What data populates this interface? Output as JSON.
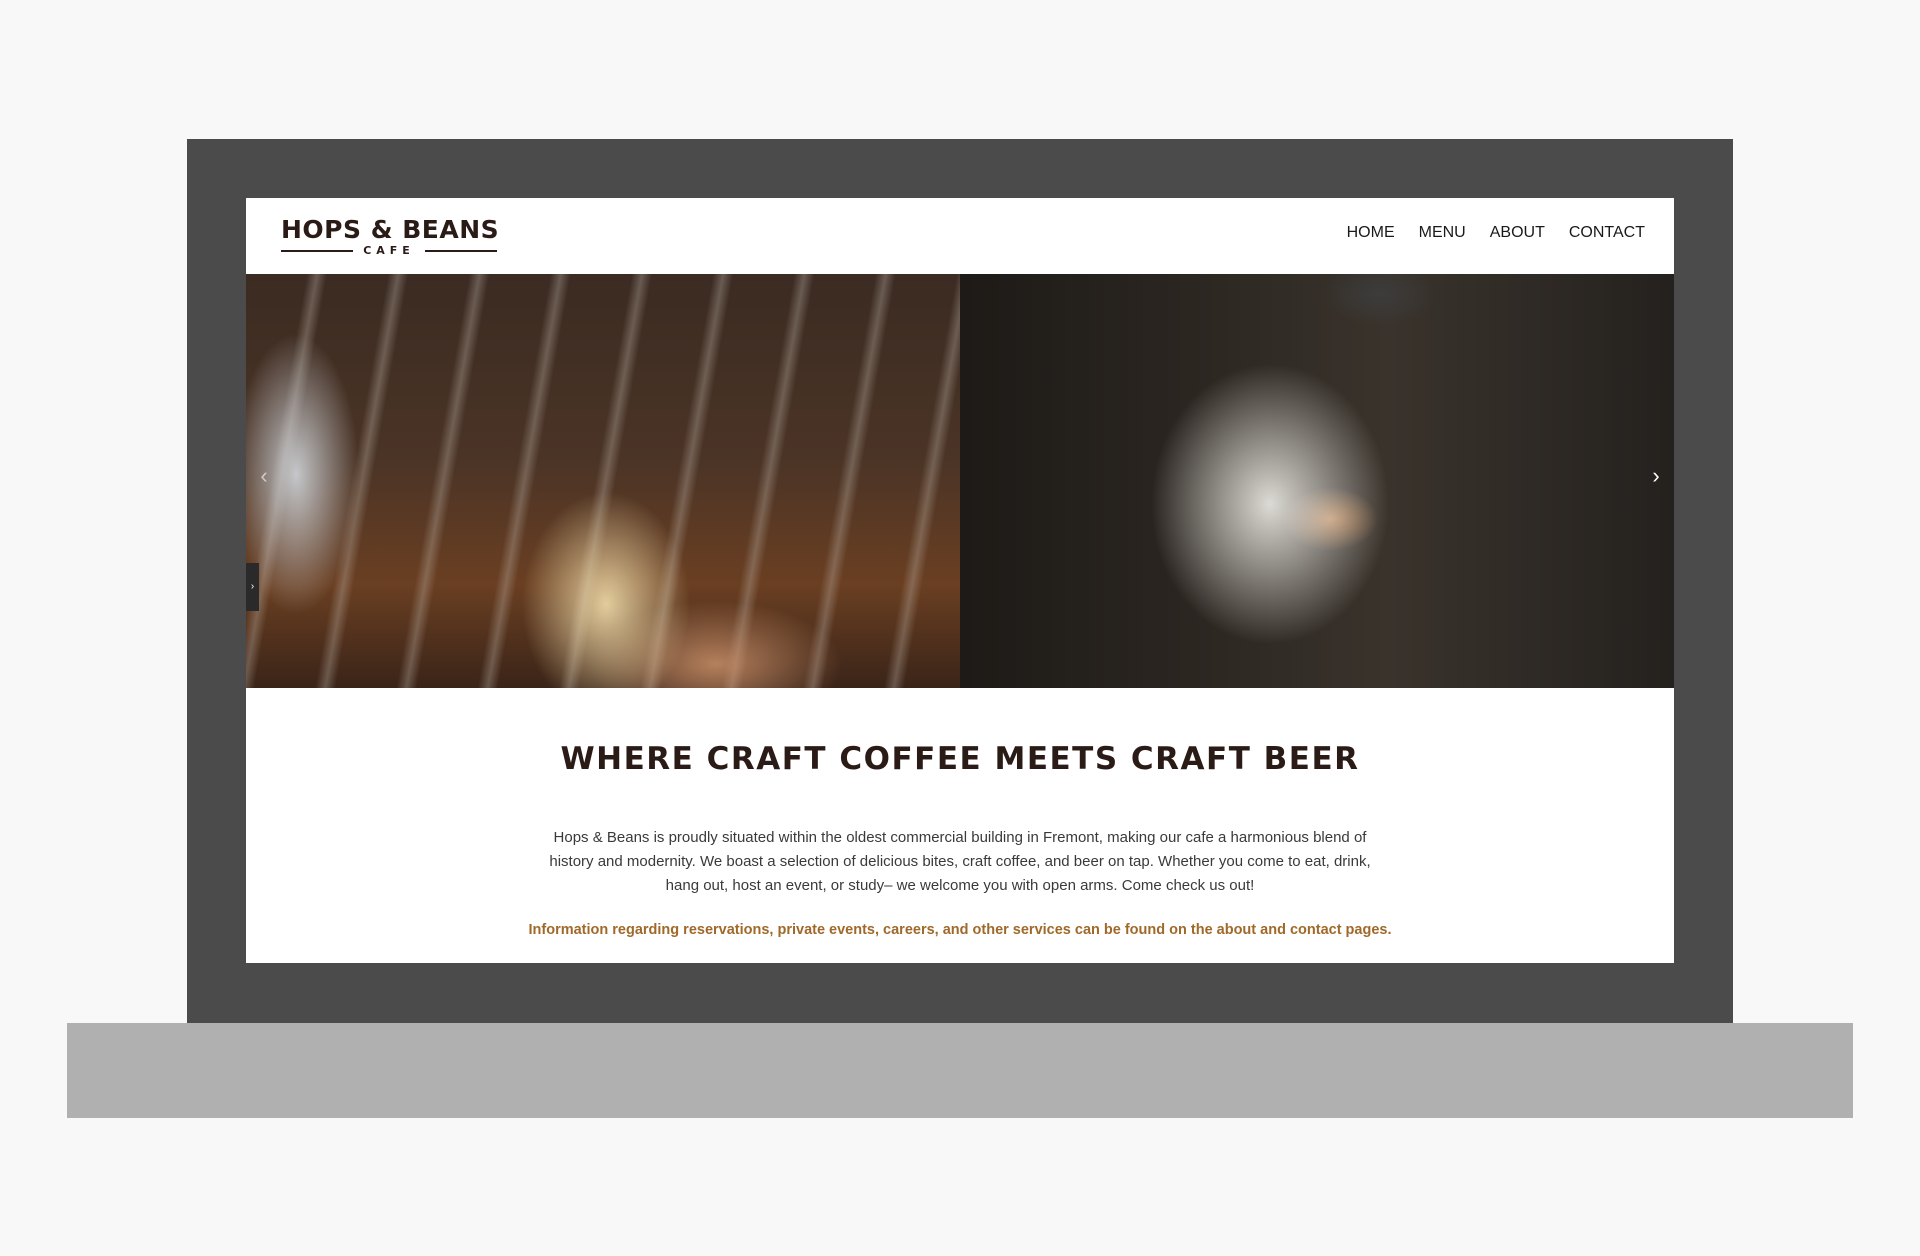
{
  "header": {
    "logo": {
      "main": "HOPS & BEANS",
      "sub": "CAFE"
    },
    "nav": [
      "HOME",
      "MENU",
      "ABOUT",
      "CONTACT"
    ]
  },
  "hero": {
    "prev_arrow": "‹",
    "next_arrow": "›",
    "side_tab": "›"
  },
  "content": {
    "headline": "WHERE CRAFT COFFEE MEETS CRAFT BEER",
    "body": "Hops & Beans is proudly situated within the oldest commercial building in Fremont, making our cafe a harmonious blend of history and modernity. We boast a selection of delicious bites, craft coffee, and beer on tap. Whether you come to eat, drink, hang out, host an event, or study– we welcome you with open arms. Come check us out!",
    "info": "Information regarding reservations, private events, careers, and other services can be found on the about and contact pages."
  },
  "colors": {
    "brand_dark": "#2a1b17",
    "accent_gold": "#a0692a",
    "laptop_bezel": "#4b4b4b",
    "laptop_base": "#b0b0b0"
  },
  "icons": {
    "logo_hop": "hop-cone-icon",
    "prev": "chevron-left-icon",
    "next": "chevron-right-icon"
  }
}
